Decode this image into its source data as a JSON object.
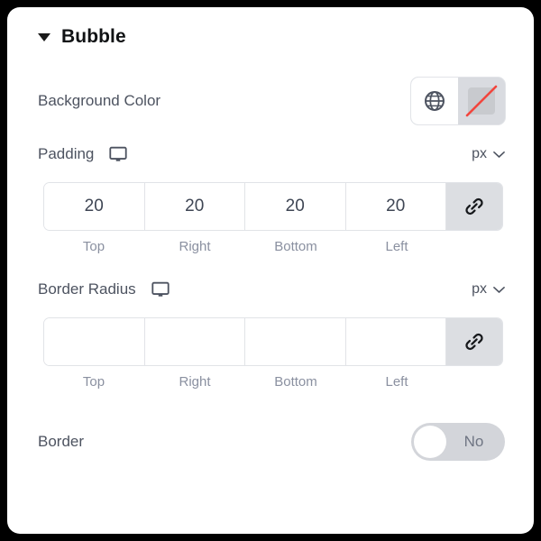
{
  "panel": {
    "section": {
      "title": "Bubble",
      "caret_icon": "caret-down-icon",
      "expanded": true
    },
    "background_color": {
      "label": "Background Color",
      "global_icon": "globe-icon",
      "swatch_icon": "no-color-swatch-icon",
      "swatch_value": "none",
      "slash_color": "#f2453d",
      "swatch_fill": "#c8cace"
    },
    "padding": {
      "label": "Padding",
      "device_icon": "desktop-icon",
      "unit": "px",
      "unit_caret_icon": "chevron-down-icon",
      "link_icon": "link-icon",
      "linked": true,
      "values": [
        "20",
        "20",
        "20",
        "20"
      ],
      "sides": [
        "Top",
        "Right",
        "Bottom",
        "Left"
      ]
    },
    "border_radius": {
      "label": "Border Radius",
      "device_icon": "desktop-icon",
      "unit": "px",
      "unit_caret_icon": "chevron-down-icon",
      "link_icon": "link-icon",
      "linked": true,
      "values": [
        "",
        "",
        "",
        ""
      ],
      "sides": [
        "Top",
        "Right",
        "Bottom",
        "Left"
      ]
    },
    "border": {
      "label": "Border",
      "toggle_state": "No",
      "enabled": false
    },
    "colors": {
      "panel_bg": "#ffffff",
      "page_bg": "#000000",
      "label_text": "#4d5360",
      "muted_text": "#8a90a0",
      "border_line": "#e1e3e7",
      "control_grey": "#d9dbe0",
      "track_grey": "#d3d5da"
    }
  }
}
